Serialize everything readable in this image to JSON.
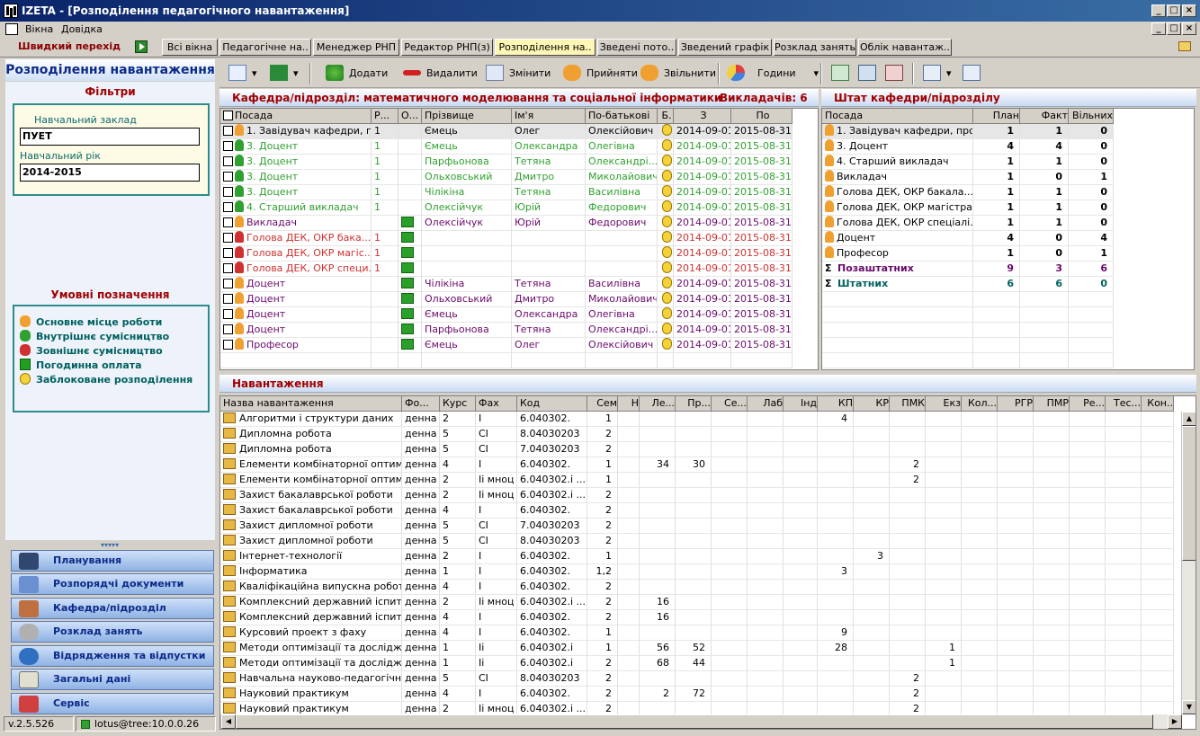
{
  "window": {
    "title": "IZETA - [Розподілення педагогічного навантаження]"
  },
  "menu": [
    "Вікна",
    "Довідка"
  ],
  "quick": "Швидкий перехід",
  "tabs": [
    "Всі вікна",
    "Педагогічне на..",
    "Менеджер РНП",
    "Редактор РНП(з)",
    "Розподілення на..",
    "Зведені пото..",
    "Зведений графік",
    "Розклад занять",
    "Облік навантаж.."
  ],
  "left": {
    "title": "Розподілення навантаження",
    "filters": "Фільтри",
    "inst_label": "Навчальний заклад",
    "inst_value": "ПУЕТ",
    "year_label": "Навчальний рік",
    "year_value": "2014-2015",
    "legend_title": "Умовні позначення",
    "legend": [
      "Основне місце роботи",
      "Внутрішнє сумісництво",
      "Зовнішнє сумісництво",
      "Погодинна оплата",
      "Заблоковане розподілення"
    ],
    "nav": [
      "Планування",
      "Розпорядчі документи",
      "Кафедра/підрозділ",
      "Розклад занять",
      "Відрядження та відпустки",
      "Загальні дані",
      "Сервіс"
    ],
    "version": "v.2.5.526",
    "server": "lotus@tree:10.0.0.26"
  },
  "toolbar": {
    "add": "Додати",
    "del": "Видалити",
    "edit": "Змінити",
    "accept": "Прийняти",
    "dismiss": "Звільнити",
    "hours": "Години"
  },
  "staff": {
    "title": "Кафедра/підрозділ: математичного моделювання та соціальної інформатики",
    "count": "Викладачів: 6",
    "headers": [
      "Посада",
      "Р...",
      "О...",
      "Прізвище",
      "Ім'я",
      "По-батькові",
      "Б.",
      "З",
      "По"
    ],
    "rows": [
      [
        "1. Завідувач кафедри, п...",
        "1",
        "",
        "Ємець",
        "Олег",
        "Олексійович",
        "",
        "2014-09-01",
        "2015-08-31"
      ],
      [
        "3. Доцент",
        "1",
        "",
        "Ємець",
        "Олександра",
        "Олегівна",
        "",
        "2014-09-01",
        "2015-08-31"
      ],
      [
        "3. Доцент",
        "1",
        "",
        "Парфьонова",
        "Тетяна",
        "Олександрі...",
        "",
        "2014-09-01",
        "2015-08-31"
      ],
      [
        "3. Доцент",
        "1",
        "",
        "Ольховський",
        "Дмитро",
        "Миколайович",
        "",
        "2014-09-01",
        "2015-08-31"
      ],
      [
        "3. Доцент",
        "1",
        "",
        "Чілікіна",
        "Тетяна",
        "Василівна",
        "",
        "2014-09-01",
        "2015-08-31"
      ],
      [
        "4. Старший викладач",
        "1",
        "",
        "Олексійчук",
        "Юрій",
        "Федорович",
        "",
        "2014-09-01",
        "2015-08-31"
      ],
      [
        "Викладач",
        "",
        "",
        "Олексійчук",
        "Юрій",
        "Федорович",
        "",
        "2014-09-01",
        "2015-08-31"
      ],
      [
        "Голова ДЕК, ОКР бака...",
        "1",
        "",
        "",
        "",
        "",
        "",
        "2014-09-01",
        "2015-08-31"
      ],
      [
        "Голова ДЕК, ОКР магіс...",
        "1",
        "",
        "",
        "",
        "",
        "",
        "2014-09-01",
        "2015-08-31"
      ],
      [
        "Голова ДЕК, ОКР специ...",
        "1",
        "",
        "",
        "",
        "",
        "",
        "2014-09-01",
        "2015-08-31"
      ],
      [
        "Доцент",
        "",
        "",
        "Чілікіна",
        "Тетяна",
        "Василівна",
        "",
        "2014-09-01",
        "2015-08-31"
      ],
      [
        "Доцент",
        "",
        "",
        "Ольховський",
        "Дмитро",
        "Миколайович",
        "",
        "2014-09-01",
        "2015-08-31"
      ],
      [
        "Доцент",
        "",
        "",
        "Ємець",
        "Олександра",
        "Олегівна",
        "",
        "2014-09-01",
        "2015-08-31"
      ],
      [
        "Доцент",
        "",
        "",
        "Парфьонова",
        "Тетяна",
        "Олександрі...",
        "",
        "2014-09-01",
        "2015-08-31"
      ],
      [
        "Професор",
        "",
        "",
        "Ємець",
        "Олег",
        "Олексійович",
        "",
        "2014-09-01",
        "2015-08-31"
      ]
    ]
  },
  "shtat": {
    "title": "Штат кафедри/підрозділу",
    "headers": [
      "Посада",
      "План",
      "Факт",
      "Вільних"
    ],
    "rows": [
      [
        "1. Завідувач кафедри, про...",
        "1",
        "1",
        "0"
      ],
      [
        "3. Доцент",
        "4",
        "4",
        "0"
      ],
      [
        "4. Старший викладач",
        "1",
        "1",
        "0"
      ],
      [
        "Викладач",
        "1",
        "0",
        "1"
      ],
      [
        "Голова ДЕК, ОКР бакала...",
        "1",
        "1",
        "0"
      ],
      [
        "Голова ДЕК, ОКР магістра",
        "1",
        "1",
        "0"
      ],
      [
        "Голова ДЕК, ОКР спеціалі...",
        "1",
        "1",
        "0"
      ],
      [
        "Доцент",
        "4",
        "0",
        "4"
      ],
      [
        "Професор",
        "1",
        "0",
        "1"
      ],
      [
        "Позаштатних",
        "9",
        "3",
        "6"
      ],
      [
        "Штатних",
        "6",
        "6",
        "0"
      ]
    ]
  },
  "load": {
    "title": "Навантаження",
    "headers": [
      "Назва навантаження",
      "Фо...",
      "Курс",
      "Фах",
      "Код",
      "Сем",
      "Н",
      "Ле...",
      "Пр...",
      "Се...",
      "Лаб",
      "Інд",
      "КП",
      "КР",
      "ПМК",
      "Екз",
      "Кол...",
      "РГР",
      "ПМР",
      "Ре...",
      "Тес...",
      "Кон.."
    ],
    "rows": [
      [
        "Алгоритми і структури даних",
        "денна",
        "2",
        "І",
        "6.040302.",
        "1",
        "",
        "",
        "",
        "",
        "",
        "",
        "4",
        "",
        "",
        "",
        "",
        "",
        "",
        "",
        "",
        ""
      ],
      [
        "Дипломна робота",
        "денна",
        "5",
        "СІ",
        "8.04030203",
        "2",
        "",
        "",
        "",
        "",
        "",
        "",
        "",
        "",
        "",
        "",
        "",
        "",
        "",
        "",
        "",
        ""
      ],
      [
        "Дипломна робота",
        "денна",
        "5",
        "СІ",
        "7.04030203",
        "2",
        "",
        "",
        "",
        "",
        "",
        "",
        "",
        "",
        "",
        "",
        "",
        "",
        "",
        "",
        "",
        ""
      ],
      [
        "Елементи комбінаторної оптимізі...",
        "денна",
        "4",
        "І",
        "6.040302.",
        "1",
        "",
        "34",
        "30",
        "",
        "",
        "",
        "",
        "",
        "2",
        "",
        "",
        "",
        "",
        "",
        "",
        ""
      ],
      [
        "Елементи комбінаторної оптимізі...",
        "денна",
        "2",
        "Іі мноц",
        "6.040302.і ...",
        "1",
        "",
        "",
        "",
        "",
        "",
        "",
        "",
        "",
        "2",
        "",
        "",
        "",
        "",
        "",
        "",
        ""
      ],
      [
        "Захист бакалаврської роботи",
        "денна",
        "2",
        "Іі мноц",
        "6.040302.і ...",
        "2",
        "",
        "",
        "",
        "",
        "",
        "",
        "",
        "",
        "",
        "",
        "",
        "",
        "",
        "",
        "",
        ""
      ],
      [
        "Захист бакалаврської роботи",
        "денна",
        "4",
        "І",
        "6.040302.",
        "2",
        "",
        "",
        "",
        "",
        "",
        "",
        "",
        "",
        "",
        "",
        "",
        "",
        "",
        "",
        "",
        ""
      ],
      [
        "Захист дипломної роботи",
        "денна",
        "5",
        "СІ",
        "7.04030203",
        "2",
        "",
        "",
        "",
        "",
        "",
        "",
        "",
        "",
        "",
        "",
        "",
        "",
        "",
        "",
        "",
        ""
      ],
      [
        "Захист дипломної роботи",
        "денна",
        "5",
        "СІ",
        "8.04030203",
        "2",
        "",
        "",
        "",
        "",
        "",
        "",
        "",
        "",
        "",
        "",
        "",
        "",
        "",
        "",
        "",
        ""
      ],
      [
        "Інтернет-технології",
        "денна",
        "2",
        "І",
        "6.040302.",
        "1",
        "",
        "",
        "",
        "",
        "",
        "",
        "",
        "3",
        "",
        "",
        "",
        "",
        "",
        "",
        "",
        ""
      ],
      [
        "Інформатика",
        "денна",
        "1",
        "І",
        "6.040302.",
        "1,2",
        "",
        "",
        "",
        "",
        "",
        "",
        "3",
        "",
        "",
        "",
        "",
        "",
        "",
        "",
        "",
        ""
      ],
      [
        "Кваліфікаційна випускна робота (...",
        "денна",
        "4",
        "І",
        "6.040302.",
        "2",
        "",
        "",
        "",
        "",
        "",
        "",
        "",
        "",
        "",
        "",
        "",
        "",
        "",
        "",
        "",
        ""
      ],
      [
        "Комплексний державний іспит",
        "денна",
        "2",
        "Іі мноц",
        "6.040302.і ...",
        "2",
        "",
        "16",
        "",
        "",
        "",
        "",
        "",
        "",
        "",
        "",
        "",
        "",
        "",
        "",
        "",
        ""
      ],
      [
        "Комплексний державний іспит",
        "денна",
        "4",
        "І",
        "6.040302.",
        "2",
        "",
        "16",
        "",
        "",
        "",
        "",
        "",
        "",
        "",
        "",
        "",
        "",
        "",
        "",
        "",
        ""
      ],
      [
        "Курсовий проект з фаху",
        "денна",
        "4",
        "І",
        "6.040302.",
        "1",
        "",
        "",
        "",
        "",
        "",
        "",
        "9",
        "",
        "",
        "",
        "",
        "",
        "",
        "",
        "",
        ""
      ],
      [
        "Методи оптимізації та досліджен...",
        "денна",
        "1",
        "Іі",
        "6.040302.і",
        "1",
        "",
        "56",
        "52",
        "",
        "",
        "",
        "28",
        "",
        "",
        "1",
        "",
        "",
        "",
        "",
        "",
        ""
      ],
      [
        "Методи оптимізації та досліджен...",
        "денна",
        "1",
        "Іі",
        "6.040302.і",
        "2",
        "",
        "68",
        "44",
        "",
        "",
        "",
        "",
        "",
        "",
        "1",
        "",
        "",
        "",
        "",
        "",
        ""
      ],
      [
        "Навчальна науково-педагогічна ...",
        "денна",
        "5",
        "СІ",
        "8.04030203",
        "2",
        "",
        "",
        "",
        "",
        "",
        "",
        "",
        "",
        "2",
        "",
        "",
        "",
        "",
        "",
        "",
        ""
      ],
      [
        "Науковий практикум",
        "денна",
        "4",
        "І",
        "6.040302.",
        "2",
        "",
        "2",
        "72",
        "",
        "",
        "",
        "",
        "",
        "2",
        "",
        "",
        "",
        "",
        "",
        "",
        ""
      ],
      [
        "Науковий практикум",
        "денна",
        "2",
        "Іі мноц",
        "6.040302.і ...",
        "2",
        "",
        "",
        "",
        "",
        "",
        "",
        "",
        "",
        "2",
        "",
        "",
        "",
        "",
        "",
        "",
        ""
      ]
    ]
  },
  "colors": {
    "main": "#f0a030",
    "internal": "#30a030",
    "external": "#d03030",
    "hourly": "#20a020",
    "green_text": "#006060",
    "purple_text": "#6a0a6a"
  }
}
